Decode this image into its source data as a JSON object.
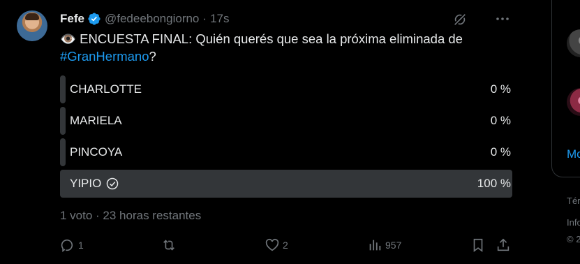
{
  "tweet": {
    "display_name": "Fefe",
    "handle": "@fedeebongiorno",
    "separator": "·",
    "time": "17s",
    "emoji": "👁️",
    "text_main": " ENCUESTA FINAL: Quién querés que sea la próxima eliminada de",
    "hashtag": "#GranHermano",
    "text_end": "?"
  },
  "poll": {
    "options": [
      {
        "label": "CHARLOTTE",
        "percent": "0 %",
        "fill": 0.012
      },
      {
        "label": "MARIELA",
        "percent": "0 %",
        "fill": 0.012
      },
      {
        "label": "PINCOYA",
        "percent": "0 %",
        "fill": 0.012
      },
      {
        "label": "YIPIO",
        "percent": "100 %",
        "fill": 1.0,
        "winner": true
      }
    ],
    "meta": "1 voto · 23 horas restantes"
  },
  "actions": {
    "reply_count": "1",
    "retweet_count": "",
    "like_count": "2",
    "view_count": "957"
  },
  "sidebar": {
    "more_link": "Mo",
    "footer_1": "Térn",
    "footer_2": "Info",
    "footer_3": "© 2"
  },
  "colors": {
    "background": "#000000",
    "text": "#e7e9ea",
    "muted": "#71767b",
    "accent": "#1d9bf0",
    "poll_bar": "#333639"
  }
}
